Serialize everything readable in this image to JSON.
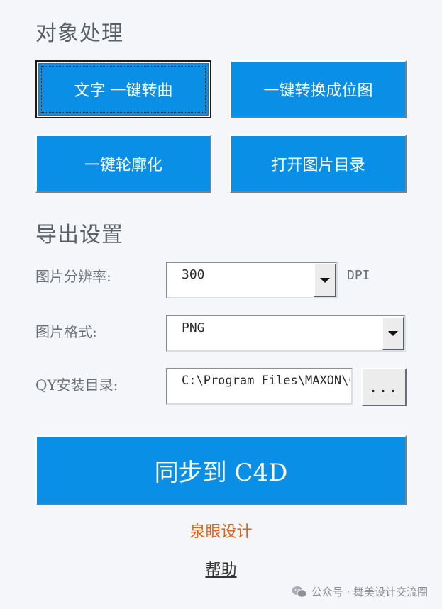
{
  "sections": {
    "object_processing": "对象处理",
    "export_settings": "导出设置"
  },
  "buttons": {
    "text_to_curve": "文字 一键转曲",
    "to_bitmap": "一键转换成位图",
    "outline": "一键轮廓化",
    "open_image_dir": "打开图片目录",
    "sync": "同步到 C4D",
    "browse": "..."
  },
  "export": {
    "resolution_label": "图片分辨率:",
    "resolution_value": "300",
    "resolution_unit": "DPI",
    "format_label": "图片格式:",
    "format_value": "PNG",
    "install_dir_label": "QY安装目录:",
    "install_dir_value": "C:\\Program Files\\MAXON\\C"
  },
  "footer": {
    "brand": "泉眼设计",
    "help": "帮助",
    "watermark": "公众号 · 舞美设计交流圈"
  },
  "colors": {
    "button_blue": "#0a8fe6",
    "brand_orange": "#e0621a",
    "background": "#f4f6f9"
  },
  "icons": {
    "dropdown": "chevron-down-icon",
    "watermark": "wechat-icon"
  }
}
